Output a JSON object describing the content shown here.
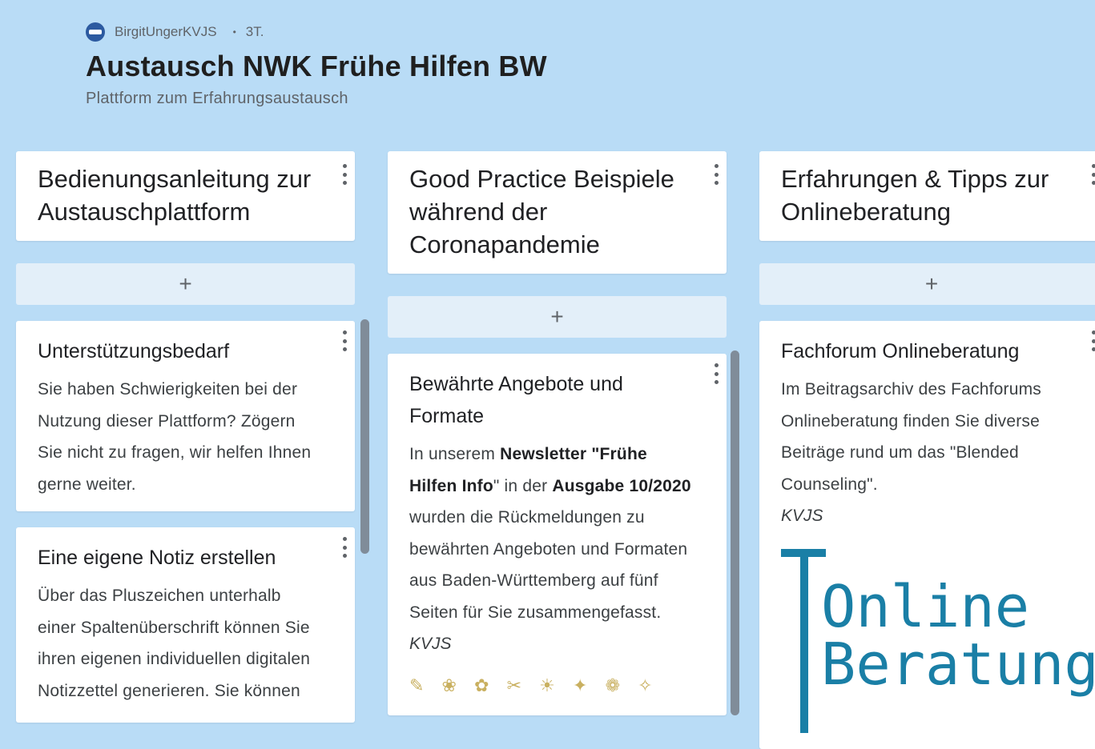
{
  "header": {
    "author": "BirgitUngerKVJS",
    "age": "3T.",
    "title": "Austausch NWK Frühe Hilfen BW",
    "subtitle": "Plattform zum Erfahrungsaustausch"
  },
  "add_label": "+",
  "columns": [
    {
      "title": "Bedienungsanleitung zur Austauschplattform",
      "cards": [
        {
          "title": "Unterstützungsbedarf",
          "body": "Sie haben Schwierigkeiten bei der Nutzung dieser Plattform? Zögern Sie nicht zu fragen, wir helfen Ihnen gerne weiter."
        },
        {
          "title": "Eine eigene Notiz erstellen",
          "body": "Über das Pluszeichen unterhalb einer Spaltenüberschrift können Sie ihren eigenen individuellen digitalen Notizzettel generieren. Sie können"
        }
      ]
    },
    {
      "title": "Good Practice Beispiele während der Coronapandemie",
      "cards": [
        {
          "title": "Bewährte Angebote und Formate",
          "body_parts": [
            "In unserem ",
            "Newsletter",
            " \"",
            "Frühe Hilfen Info",
            "\" in der ",
            "Ausgabe 10/2020",
            " wurden die Rückmeldungen zu bewährten Angeboten und Formaten aus Baden-Württemberg auf fünf Seiten für Sie zusammengefasst."
          ],
          "author": "KVJS"
        }
      ]
    },
    {
      "title": "Erfahrungen & Tipps zur Onlineberatung",
      "cards": [
        {
          "title": "Fachforum Onlineberatung",
          "body": "Im Beitragsarchiv des Fachforums Onlineberatung finden Sie diverse Beiträge rund um das \"Blended Counseling\".",
          "author": "KVJS",
          "logo_text": "Online\nBeratung"
        }
      ]
    }
  ],
  "colors": {
    "background": "#b9dcf6",
    "add_row": "#e3eff9",
    "logo": "#1a7fa6",
    "scrollbar": "#808c99"
  }
}
